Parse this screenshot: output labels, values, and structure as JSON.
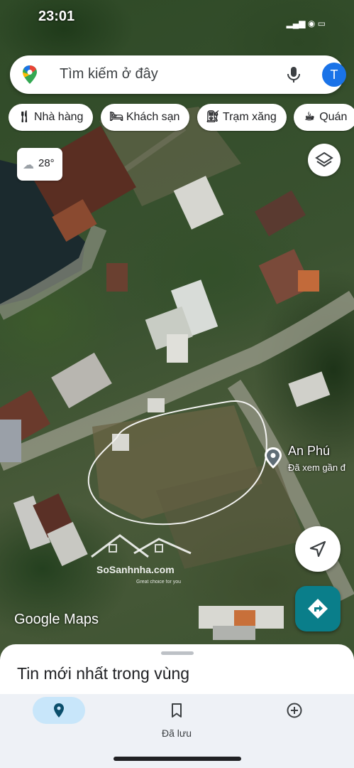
{
  "status": {
    "time": "23:01"
  },
  "search": {
    "placeholder": "Tìm kiếm ở đây",
    "avatar_letter": "T"
  },
  "chips": [
    {
      "icon": "utensils-icon",
      "label": "Nhà hàng"
    },
    {
      "icon": "bed-icon",
      "label": "Khách sạn"
    },
    {
      "icon": "gas-station-icon",
      "label": "Trạm xăng"
    },
    {
      "icon": "coffee-icon",
      "label": "Quán"
    }
  ],
  "weather": {
    "temp": "28°",
    "icon": "cloud-icon"
  },
  "place": {
    "name": "An Phú",
    "subtitle": "Đã xem gần đ"
  },
  "watermark": {
    "title": "SoSanhnha.com",
    "tagline": "Great choice for you"
  },
  "attribution": "Google Maps",
  "sheet": {
    "title": "Tin mới nhất trong vùng"
  },
  "nav": [
    {
      "icon": "explore-pin-icon",
      "label": "",
      "active": true
    },
    {
      "icon": "bookmark-icon",
      "label": "Đã lưu",
      "active": false
    },
    {
      "icon": "add-circle-icon",
      "label": "",
      "active": false
    }
  ],
  "colors": {
    "accent": "#1a73e8",
    "directions": "#0a7e8a",
    "nav_active": "#c8e6fa"
  }
}
